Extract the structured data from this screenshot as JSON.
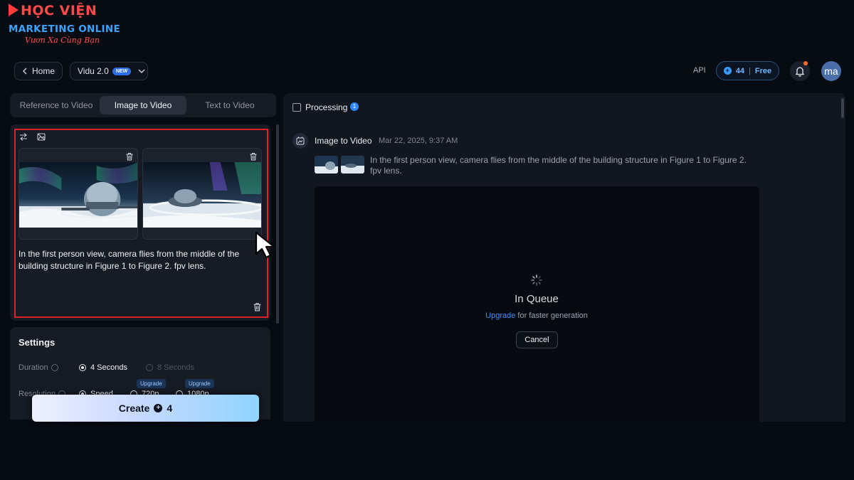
{
  "logo": {
    "top": "HỌC VIỆN",
    "middle": "MARKETING ONLINE",
    "tagline": "Vươn Xa Cùng Bạn"
  },
  "header": {
    "home_label": "Home",
    "model_label": "Vidu 2.0",
    "model_badge": "NEW",
    "api_label": "API",
    "credits_value": "44",
    "credits_sep": "|",
    "credits_plan": "Free",
    "avatar_initials": "ma"
  },
  "tabs": [
    {
      "label": "Reference to Video",
      "active": false
    },
    {
      "label": "Image to Video",
      "active": true
    },
    {
      "label": "Text to Video",
      "active": false
    }
  ],
  "input": {
    "prompt": "In the first person view, camera flies from the middle of the building structure in Figure 1 to Figure 2. fpv lens."
  },
  "settings": {
    "title": "Settings",
    "duration_label": "Duration",
    "duration_options": [
      {
        "label": "4 Seconds",
        "selected": true,
        "enabled": true
      },
      {
        "label": "8 Seconds",
        "selected": false,
        "enabled": false
      }
    ],
    "resolution_label": "Resolution",
    "resolution_options": [
      {
        "label": "Speed",
        "selected": true,
        "badge": ""
      },
      {
        "label": "720p",
        "selected": false,
        "badge": "Upgrade"
      },
      {
        "label": "1080p",
        "selected": false,
        "badge": "Upgrade"
      }
    ]
  },
  "create": {
    "label": "Create",
    "cost": "4"
  },
  "processing": {
    "label": "Processing",
    "count": "1",
    "task": {
      "title": "Image to Video",
      "time": "Mar 22, 2025, 9:37 AM",
      "prompt": "In the first person view, camera flies from the middle of the building structure in Figure 1 to Figure 2. fpv lens.",
      "status": "In Queue",
      "upgrade_link": "Upgrade",
      "upgrade_suffix": " for faster generation",
      "cancel_label": "Cancel"
    }
  },
  "colors": {
    "background": "#070b12",
    "panel": "#161b24",
    "accent": "#3d8fff",
    "highlight_frame": "#e0202a"
  },
  "icons": [
    "chevron-left-icon",
    "chevron-down-icon",
    "coin-icon",
    "bell-icon",
    "swap-icon",
    "image-edit-icon",
    "trash-icon",
    "task-icon",
    "spinner-icon",
    "cursor-icon"
  ]
}
